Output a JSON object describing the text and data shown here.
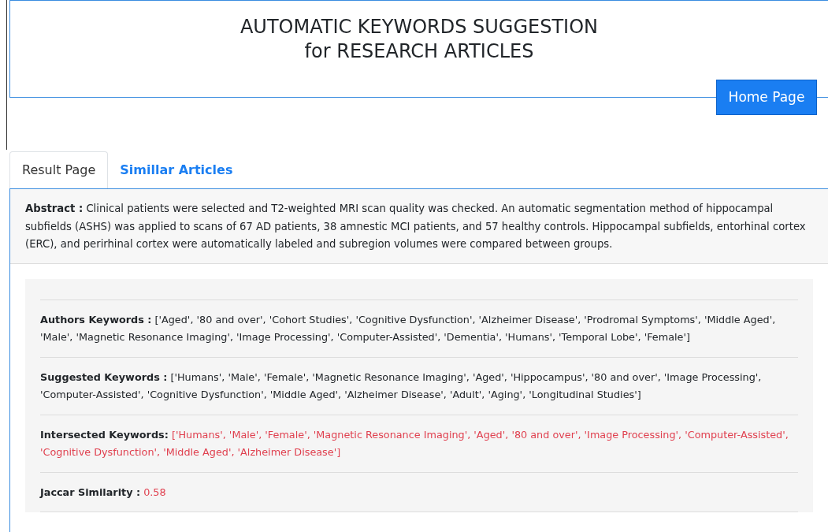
{
  "header": {
    "title_lines": [
      "AUTOMATIC KEYWORDS SUGGESTION",
      "for RESEARCH ARTICLES"
    ],
    "home_button": "Home Page"
  },
  "tabs": [
    {
      "label": "Result Page",
      "selected": true
    },
    {
      "label": "Simillar Articles",
      "selected": false
    }
  ],
  "abstract": {
    "label": "Abstract :",
    "text": "Clinical patients were selected and T2-weighted MRI scan quality was checked. An automatic segmentation method of hippocampal subfields (ASHS) was applied to scans of 67 AD patients, 38 amnestic MCI patients, and 57 healthy controls. Hippocampal subfields, entorhinal cortex (ERC), and perirhinal cortex were automatically labeled and subregion volumes were compared between groups."
  },
  "results": [
    {
      "label": "Authors Keywords :",
      "value": "['Aged', '80 and over', 'Cohort Studies', 'Cognitive Dysfunction', 'Alzheimer Disease', 'Prodromal Symptoms', 'Middle Aged', 'Male', 'Magnetic Resonance Imaging', 'Image Processing', 'Computer-Assisted', 'Dementia', 'Humans', 'Temporal Lobe', 'Female']",
      "highlighted": false
    },
    {
      "label": "Suggested Keywords :",
      "value": "['Humans', 'Male', 'Female', 'Magnetic Resonance Imaging', 'Aged', 'Hippocampus', '80 and over', 'Image Processing', 'Computer-Assisted', 'Cognitive Dysfunction', 'Middle Aged', 'Alzheimer Disease', 'Adult', 'Aging', 'Longitudinal Studies']",
      "highlighted": false
    },
    {
      "label": "Intersected Keywords:",
      "value": "['Humans', 'Male', 'Female', 'Magnetic Resonance Imaging', 'Aged', '80 and over', 'Image Processing', 'Computer-Assisted', 'Cognitive Dysfunction', 'Middle Aged', 'Alzheimer Disease']",
      "highlighted": true
    },
    {
      "label": "Jaccar Similarity :",
      "value": "0.58",
      "highlighted": true
    }
  ]
}
